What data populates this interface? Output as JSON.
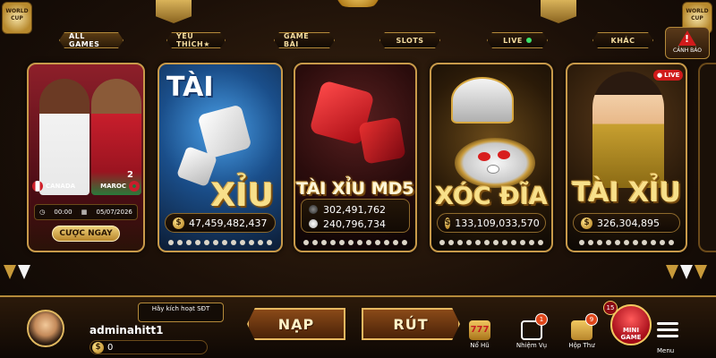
{
  "nav": {
    "tabs": [
      {
        "label": "ALL GAMES",
        "active": true
      },
      {
        "label": "YÊU THÍCH★",
        "active": false
      },
      {
        "label": "GAME BÀI",
        "active": false
      },
      {
        "label": "SLOTS",
        "active": false
      },
      {
        "label": "LIVE",
        "active": false,
        "indicator": "green-dot"
      },
      {
        "label": "KHÁC",
        "active": false
      }
    ],
    "warning": {
      "label": "CẢNH BÁO",
      "icon": "warning-icon",
      "glyph": "!"
    }
  },
  "badges": {
    "worldcup_left": "WORLD CUP",
    "worldcup_right": "WORLD CUP"
  },
  "match_card": {
    "team_home": "CANADA",
    "team_away": "MAROC",
    "time": "00:00",
    "date": "05/07/2026",
    "bet_button": "CƯỢC NGAY",
    "jersey_numbers": [
      "2"
    ]
  },
  "cards": [
    {
      "title_top": "TÀI",
      "title_bottom": "XỈU",
      "jackpot": "47,459,482,437",
      "currency": "$"
    },
    {
      "title": "TÀI XỈU MD5",
      "jackpots": [
        "302,491,762",
        "240,796,734"
      ]
    },
    {
      "title": "XÓC ĐĨA",
      "jackpot": "133,109,033,570",
      "currency": "$"
    },
    {
      "title": "TÀI XỈU",
      "jackpot": "326,304,895",
      "currency": "$",
      "live_badge": "LIVE"
    }
  ],
  "user": {
    "activate_text": "Hãy kích hoạt SĐT",
    "username": "adminahitt1",
    "balance": "0",
    "currency": "$"
  },
  "actions": {
    "deposit": "NẠP",
    "withdraw": "RÚT"
  },
  "menu": {
    "items": [
      {
        "label": "Nổ Hũ",
        "icon": "jackpot-777-icon"
      },
      {
        "label": "Nhiệm Vụ",
        "icon": "gift-icon",
        "badge": "1"
      },
      {
        "label": "Hộp Thư",
        "icon": "mail-icon",
        "badge": "9"
      }
    ],
    "minigame": {
      "label_top": "MINI",
      "label_bottom": "GAME",
      "badge": "15",
      "icon": "gamepad-icon"
    },
    "menu_label": "Menu"
  },
  "colors": {
    "gold": "#c89a4a",
    "accent_red": "#d11b1b",
    "live_green": "#3ce36b",
    "jackpot_text": "#ffffff"
  }
}
